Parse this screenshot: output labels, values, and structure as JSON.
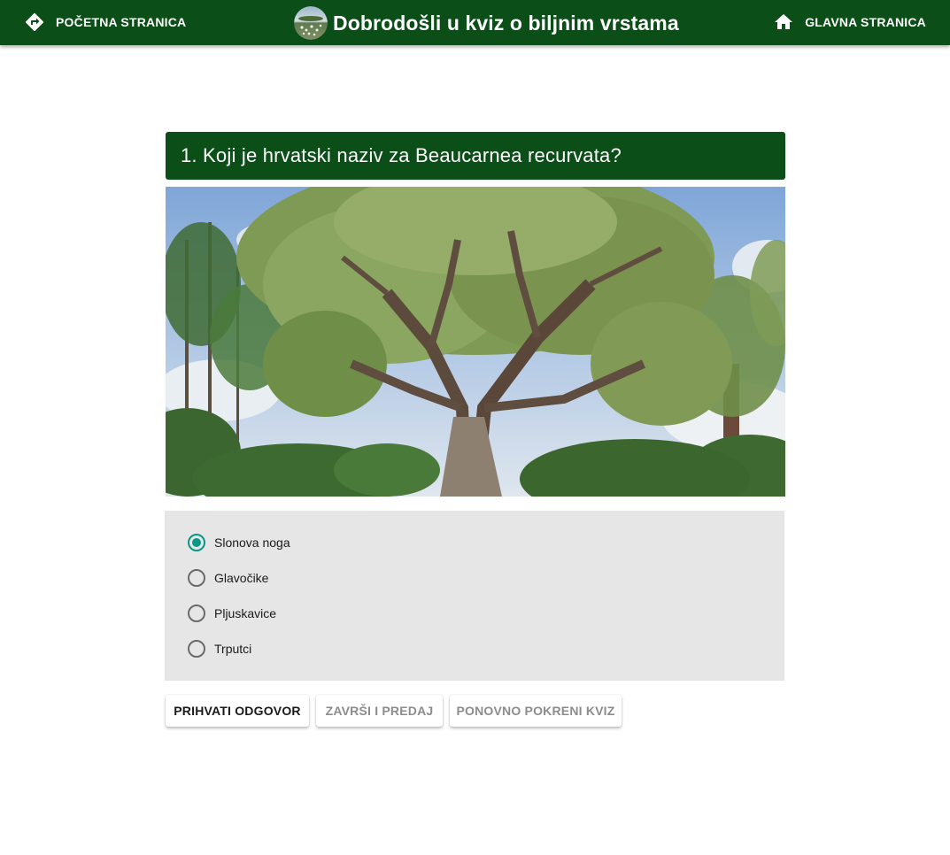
{
  "toolbar": {
    "left_nav": {
      "label": "POČETNA STRANICA",
      "icon": "directions-icon"
    },
    "title": "Dobrodošli u kviz o biljnim vrstama",
    "right_nav": {
      "label": "GLAVNA STRANICA",
      "icon": "home-icon"
    },
    "color": "#0b4e17"
  },
  "question": {
    "text": "1. Koji je hrvatski naziv za Beaucarnea recurvata?"
  },
  "options": [
    {
      "label": "Slonova noga",
      "selected": true
    },
    {
      "label": "Glavočike",
      "selected": false
    },
    {
      "label": "Pljuskavice",
      "selected": false
    },
    {
      "label": "Trputci",
      "selected": false
    }
  ],
  "buttons": {
    "accept": "PRIHVATI ODGOVOR",
    "finish": "ZAVRŠI I PREDAJ",
    "restart": "PONOVNO POKRENI KVIZ"
  },
  "colors": {
    "accent": "#0a9688",
    "panel": "#e6e6e6"
  }
}
